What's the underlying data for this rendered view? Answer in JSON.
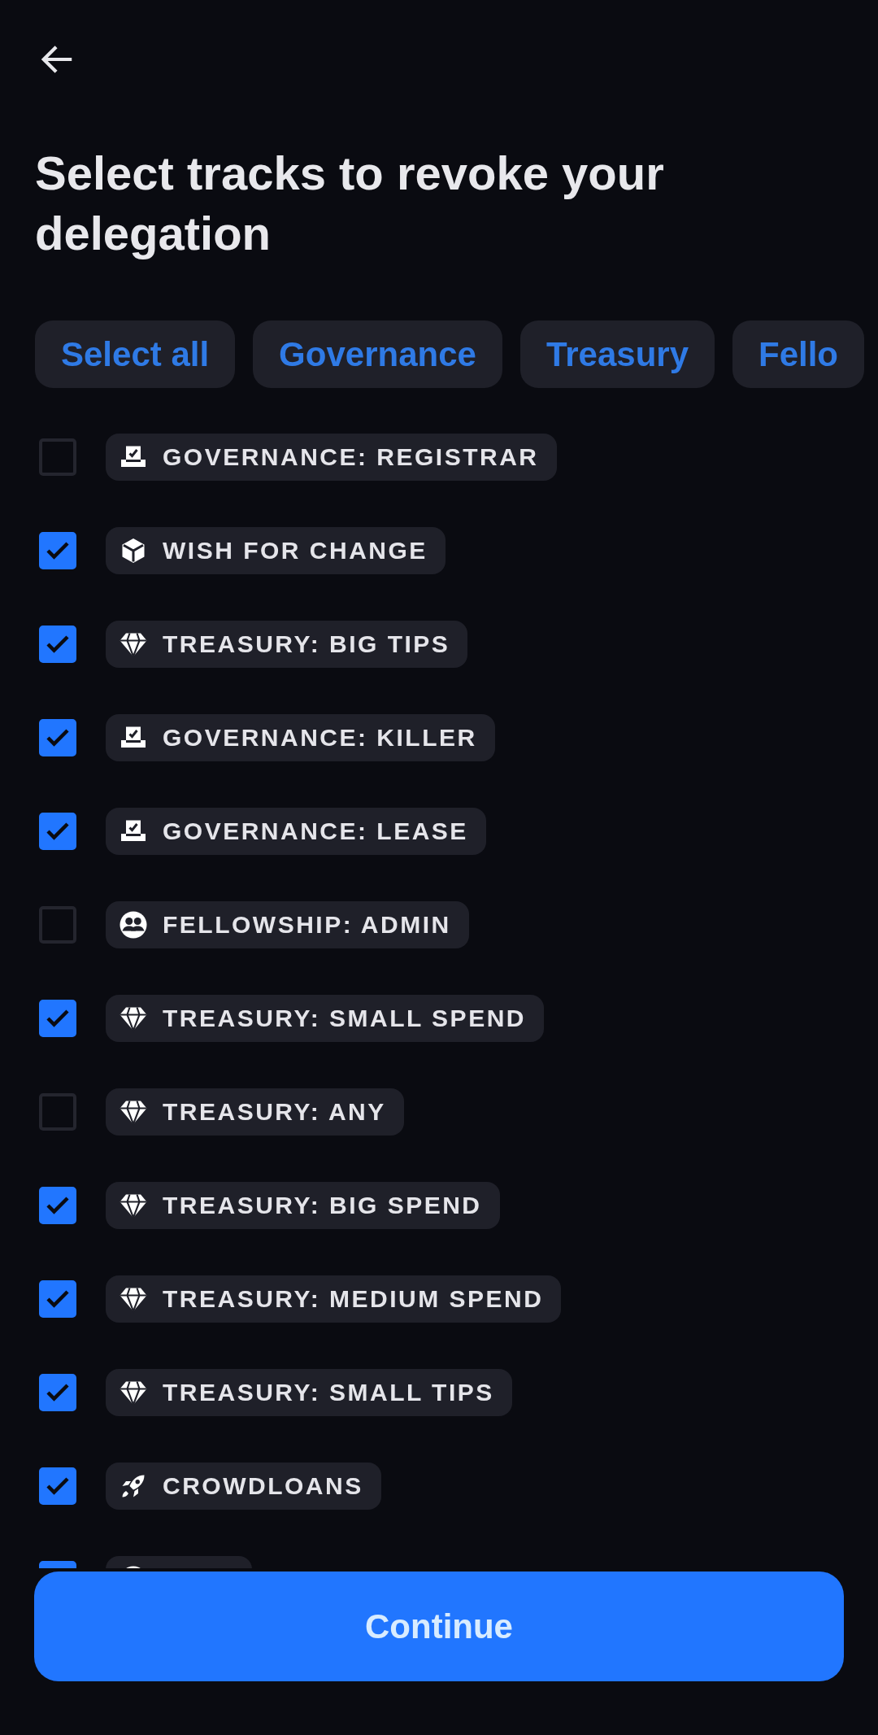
{
  "title": "Select tracks to revoke your delegation",
  "filters": [
    {
      "label": "Select all"
    },
    {
      "label": "Governance"
    },
    {
      "label": "Treasury"
    },
    {
      "label": "Fello"
    }
  ],
  "tracks": [
    {
      "label": "GOVERNANCE: REGISTRAR",
      "kind": "ballot",
      "checked": false
    },
    {
      "label": "WISH FOR CHANGE",
      "kind": "cube",
      "checked": true
    },
    {
      "label": "TREASURY: BIG TIPS",
      "kind": "diamond",
      "checked": true
    },
    {
      "label": "GOVERNANCE: KILLER",
      "kind": "ballot",
      "checked": true
    },
    {
      "label": "GOVERNANCE: LEASE",
      "kind": "ballot",
      "checked": true
    },
    {
      "label": "FELLOWSHIP: ADMIN",
      "kind": "people",
      "checked": false
    },
    {
      "label": "TREASURY: SMALL SPEND",
      "kind": "diamond",
      "checked": true
    },
    {
      "label": "TREASURY: ANY",
      "kind": "diamond",
      "checked": false
    },
    {
      "label": "TREASURY: BIG SPEND",
      "kind": "diamond",
      "checked": true
    },
    {
      "label": "TREASURY: MEDIUM SPEND",
      "kind": "diamond",
      "checked": true
    },
    {
      "label": "TREASURY: SMALL TIPS",
      "kind": "diamond",
      "checked": true
    },
    {
      "label": "CROWDLOANS",
      "kind": "rocket",
      "checked": true
    },
    {
      "kind": "circle",
      "checked": true
    }
  ],
  "continue_button": {
    "label": "Continue"
  }
}
